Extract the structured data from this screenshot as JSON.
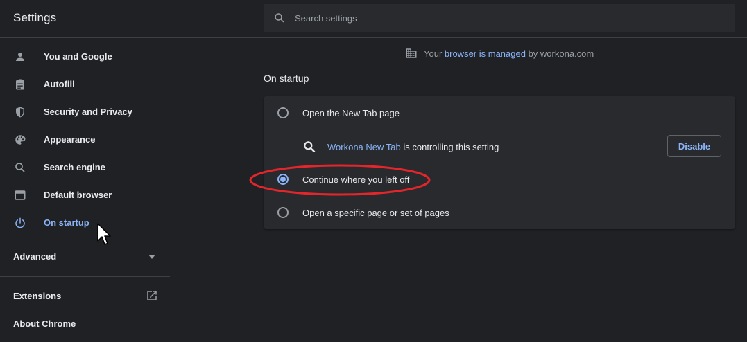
{
  "header": {
    "title": "Settings",
    "search_placeholder": "Search settings"
  },
  "sidebar": {
    "items": [
      {
        "label": "You and Google",
        "icon": "person-icon"
      },
      {
        "label": "Autofill",
        "icon": "clipboard-icon"
      },
      {
        "label": "Security and Privacy",
        "icon": "shield-icon"
      },
      {
        "label": "Appearance",
        "icon": "palette-icon"
      },
      {
        "label": "Search engine",
        "icon": "search-icon"
      },
      {
        "label": "Default browser",
        "icon": "browser-window-icon"
      },
      {
        "label": "On startup",
        "icon": "power-icon",
        "active": true
      }
    ],
    "advanced_label": "Advanced",
    "extensions_label": "Extensions",
    "about_label": "About Chrome"
  },
  "managed_notice": {
    "prefix": "Your ",
    "link": "browser is managed",
    "suffix": " by workona.com"
  },
  "on_startup": {
    "section_title": "On startup",
    "options": [
      {
        "label": "Open the New Tab page",
        "selected": false
      },
      {
        "label": "Continue where you left off",
        "selected": true
      },
      {
        "label": "Open a specific page or set of pages",
        "selected": false
      }
    ],
    "controlled_by": {
      "extension_name": "Workona New Tab",
      "text": " is controlling this setting",
      "button_label": "Disable"
    }
  },
  "colors": {
    "background": "#202124",
    "card": "#292a2d",
    "accent": "#8ab4f8",
    "annotation": "#e3262b"
  }
}
